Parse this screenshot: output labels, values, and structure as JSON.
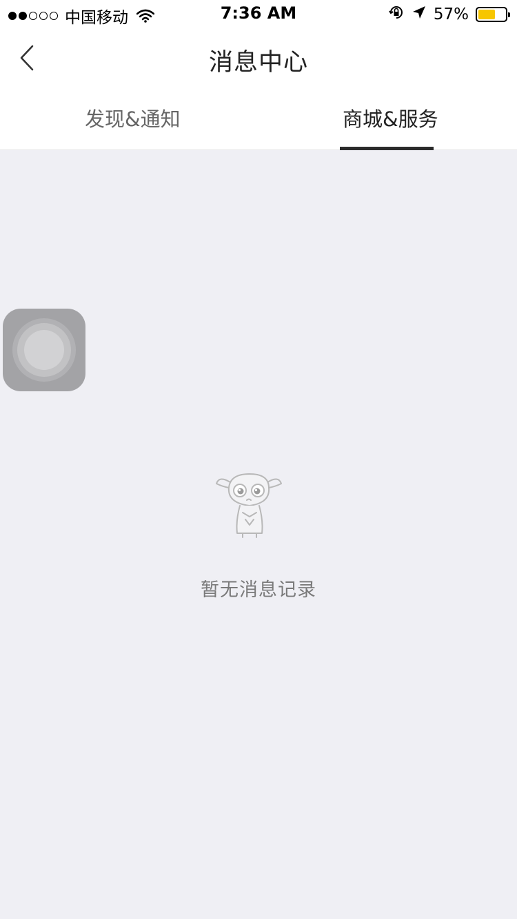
{
  "status_bar": {
    "carrier": "中国移动",
    "time": "7:36 AM",
    "battery_percent": "57%",
    "battery_level": 0.57,
    "signal_bars_filled": 2,
    "signal_bars_total": 5,
    "battery_color": "#f7c600"
  },
  "nav": {
    "title": "消息中心",
    "back_icon": "chevron-left-icon"
  },
  "tabs": [
    {
      "label": "发现&通知",
      "active": false
    },
    {
      "label": "商城&服务",
      "active": true
    }
  ],
  "empty_state": {
    "icon": "sad-mascot-illustration",
    "message": "暂无消息记录"
  },
  "assistive_touch": {
    "icon": "assistive-touch-icon"
  },
  "colors": {
    "background": "#efeff4",
    "header": "#ffffff",
    "active_tab_indicator": "#2b2b2b"
  }
}
